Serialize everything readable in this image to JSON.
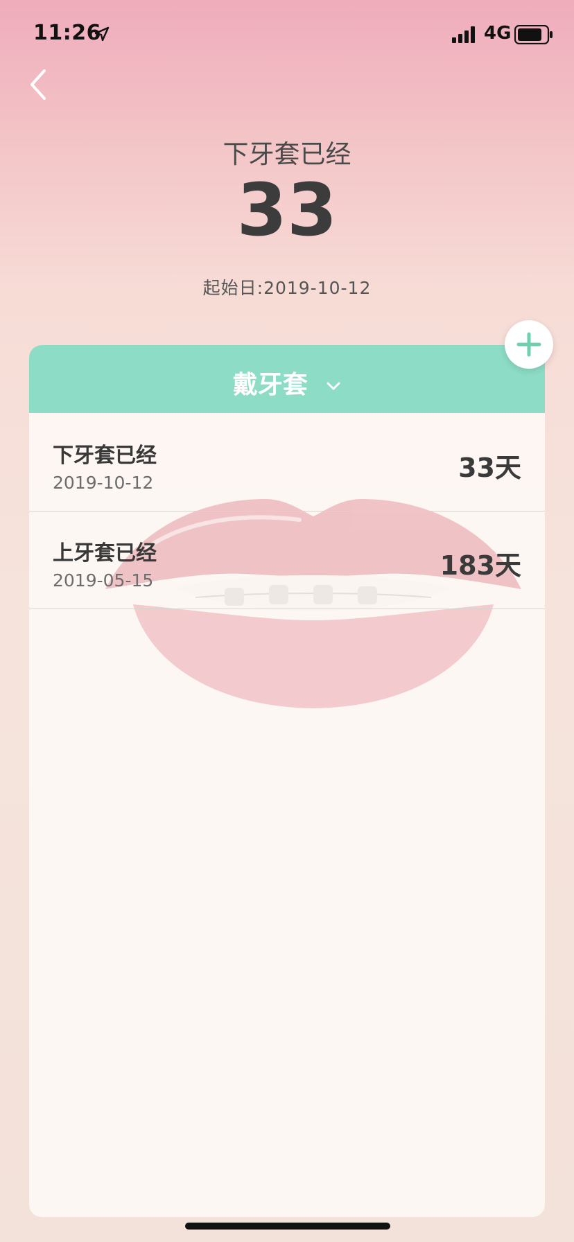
{
  "status_bar": {
    "time": "11:26",
    "network": "4G"
  },
  "header": {
    "counter_title": "下牙套已经",
    "counter_value": "33",
    "start_date": "起始日:2019-10-12"
  },
  "card": {
    "title": "戴牙套",
    "items": [
      {
        "title": "下牙套已经",
        "date": "2019-10-12",
        "days": "33天"
      },
      {
        "title": "上牙套已经",
        "date": "2019-05-15",
        "days": "183天"
      }
    ]
  },
  "colors": {
    "accent": "#8ddcc5",
    "add_icon": "#6fcfae"
  },
  "icons": {
    "back": "chevron-left-icon",
    "add": "plus-icon",
    "dropdown": "chevron-down-icon",
    "location": "location-arrow-icon",
    "signal": "signal-icon",
    "battery": "battery-icon"
  }
}
